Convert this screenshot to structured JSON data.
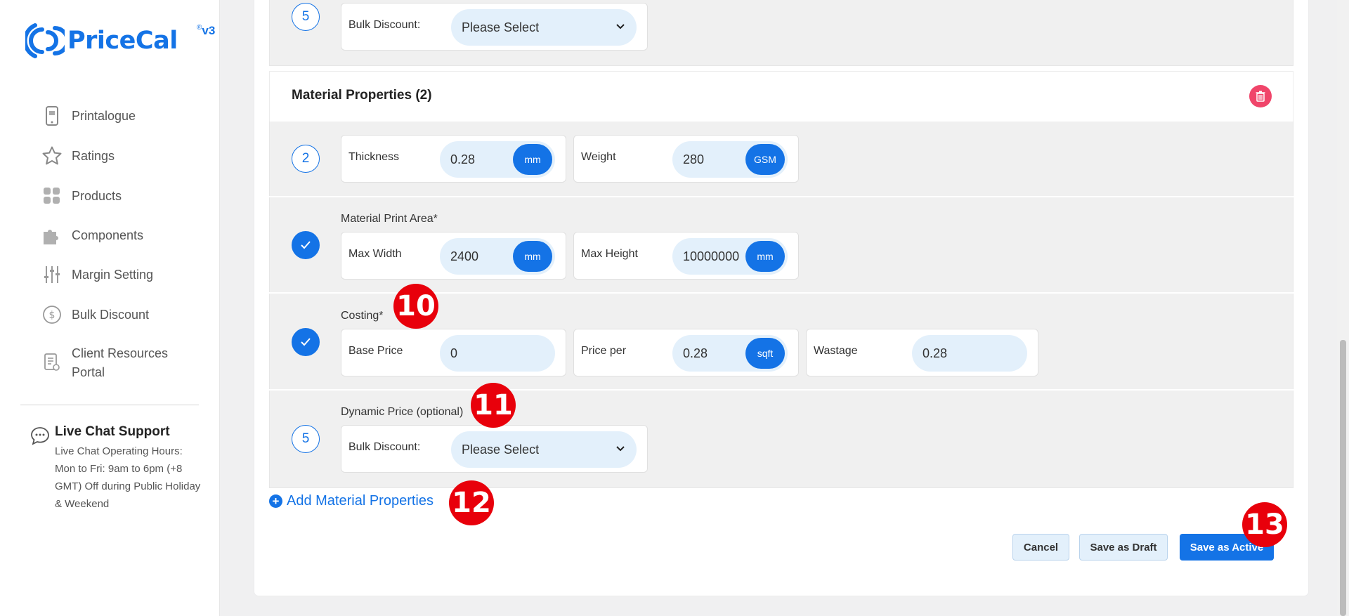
{
  "brand": {
    "name": "PriceCal",
    "version": "v3",
    "reg": "®"
  },
  "sidebar": {
    "items": [
      {
        "label": "Printalogue",
        "icon": "phone-icon"
      },
      {
        "label": "Ratings",
        "icon": "star-icon"
      },
      {
        "label": "Products",
        "icon": "grid-icon"
      },
      {
        "label": "Components",
        "icon": "puzzle-icon"
      },
      {
        "label": "Margin Setting",
        "icon": "sliders-icon"
      },
      {
        "label": "Bulk Discount",
        "icon": "dollar-icon"
      },
      {
        "label": "Client Resources Portal",
        "icon": "document-icon"
      }
    ],
    "chat": {
      "title": "Live Chat Support",
      "hours": "Live Chat Operating Hours: Mon to Fri: 9am to 6pm (+8 GMT) Off during Public Holiday & Weekend"
    }
  },
  "top_section": {
    "step": "5",
    "bulk_label": "Bulk Discount:",
    "bulk_value": "Please Select"
  },
  "material": {
    "title": "Material Properties (2)",
    "row1": {
      "step": "2",
      "thickness_label": "Thickness",
      "thickness_value": "0.28",
      "thickness_unit": "mm",
      "weight_label": "Weight",
      "weight_value": "280",
      "weight_unit": "GSM"
    },
    "row2": {
      "title": "Material Print Area*",
      "max_width_label": "Max Width",
      "max_width_value": "2400",
      "max_width_unit": "mm",
      "max_height_label": "Max Height",
      "max_height_value": "10000000",
      "max_height_unit": "mm"
    },
    "row3": {
      "title": "Costing*",
      "base_label": "Base Price",
      "base_value": "0",
      "price_per_label": "Price per",
      "price_per_value": "0.28",
      "price_per_unit": "sqft",
      "wastage_label": "Wastage",
      "wastage_value": "0.28"
    },
    "row4": {
      "title": "Dynamic Price (optional)",
      "step": "5",
      "bulk_label": "Bulk Discount:",
      "bulk_value": "Please Select"
    }
  },
  "add_material_label": "Add Material Properties",
  "buttons": {
    "cancel": "Cancel",
    "draft": "Save as Draft",
    "active": "Save as Active"
  },
  "badges": [
    "10",
    "11",
    "12",
    "13"
  ],
  "colors": {
    "accent": "#1473e6",
    "badge": "#e8000b",
    "danger": "#f0456a",
    "pill": "#e3f0fb"
  }
}
